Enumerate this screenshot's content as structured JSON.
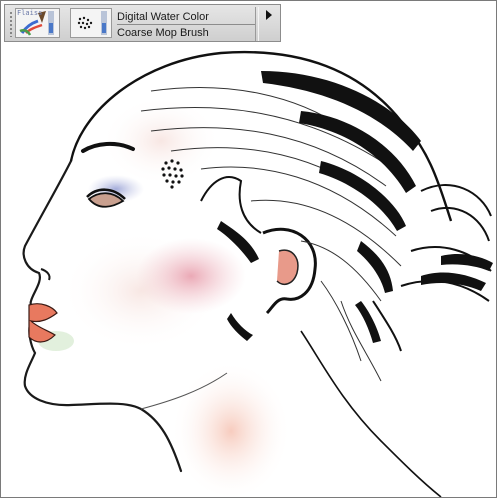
{
  "toolbar": {
    "category_name": "Digital Water Color",
    "variant_name": "Coarse Mop Brush",
    "variant_tag": "Flaiss",
    "icons": {
      "category": "brush-category-icon",
      "dab": "dab-profile-icon",
      "flyout": "triangle-right-icon"
    }
  },
  "canvas": {
    "subject": "watercolor-face-illustration",
    "colors": {
      "background": "#ffffff",
      "skin_blush": "#e9a6b2",
      "eyeshadow": "#9aa3d6",
      "lips": "#e8795f",
      "hair_ink": "#111111"
    }
  }
}
